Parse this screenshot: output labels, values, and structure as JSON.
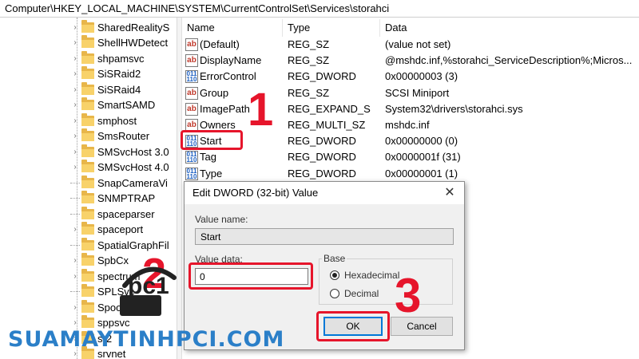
{
  "address_bar": "Computer\\HKEY_LOCAL_MACHINE\\SYSTEM\\CurrentControlSet\\Services\\storahci",
  "tree": {
    "items": [
      {
        "label": "SharedRealityS",
        "expandable": true
      },
      {
        "label": "ShellHWDetect",
        "expandable": true
      },
      {
        "label": "shpamsvc",
        "expandable": true
      },
      {
        "label": "SiSRaid2",
        "expandable": true
      },
      {
        "label": "SiSRaid4",
        "expandable": true
      },
      {
        "label": "SmartSAMD",
        "expandable": true
      },
      {
        "label": "smphost",
        "expandable": true
      },
      {
        "label": "SmsRouter",
        "expandable": true
      },
      {
        "label": "SMSvcHost 3.0",
        "expandable": true
      },
      {
        "label": "SMSvcHost 4.0",
        "expandable": true
      },
      {
        "label": "SnapCameraVi",
        "expandable": false
      },
      {
        "label": "SNMPTRAP",
        "expandable": false
      },
      {
        "label": "spaceparser",
        "expandable": false
      },
      {
        "label": "spaceport",
        "expandable": true
      },
      {
        "label": "SpatialGraphFil",
        "expandable": false
      },
      {
        "label": "SpbCx",
        "expandable": true
      },
      {
        "label": "spectrum",
        "expandable": true
      },
      {
        "label": "SPLSvc",
        "expandable": false
      },
      {
        "label": "Spooler",
        "expandable": true
      },
      {
        "label": "sppsvc",
        "expandable": true
      },
      {
        "label": "sr2",
        "expandable": true
      },
      {
        "label": "srvnet",
        "expandable": true
      }
    ]
  },
  "values_table": {
    "headers": {
      "name": "Name",
      "type": "Type",
      "data": "Data"
    },
    "rows": [
      {
        "icon": "ab",
        "name": "(Default)",
        "type": "REG_SZ",
        "data": "(value not set)"
      },
      {
        "icon": "ab",
        "name": "DisplayName",
        "type": "REG_SZ",
        "data": "@mshdc.inf,%storahci_ServiceDescription%;Micros..."
      },
      {
        "icon": "bin",
        "name": "ErrorControl",
        "type": "REG_DWORD",
        "data": "0x00000003 (3)"
      },
      {
        "icon": "ab",
        "name": "Group",
        "type": "REG_SZ",
        "data": "SCSI Miniport"
      },
      {
        "icon": "ab",
        "name": "ImagePath",
        "type": "REG_EXPAND_SZ",
        "data": "System32\\drivers\\storahci.sys"
      },
      {
        "icon": "ab",
        "name": "Owners",
        "type": "REG_MULTI_SZ",
        "data": "mshdc.inf"
      },
      {
        "icon": "bin",
        "name": "Start",
        "type": "REG_DWORD",
        "data": "0x00000000 (0)"
      },
      {
        "icon": "bin",
        "name": "Tag",
        "type": "REG_DWORD",
        "data": "0x0000001f (31)"
      },
      {
        "icon": "bin",
        "name": "Type",
        "type": "REG_DWORD",
        "data": "0x00000001 (1)"
      }
    ]
  },
  "dialog": {
    "title": "Edit DWORD (32-bit) Value",
    "close_glyph": "✕",
    "value_name_label": "Value name:",
    "value_name": "Start",
    "value_data_label": "Value data:",
    "value_data": "0",
    "base_label": "Base",
    "base_options": [
      "Hexadecimal",
      "Decimal"
    ],
    "base_selected": "Hexadecimal",
    "ok_label": "OK",
    "cancel_label": "Cancel"
  },
  "annotations": {
    "step1": "1",
    "step2": "2",
    "step3": "3"
  },
  "watermark": {
    "text": "SUAMAYTINHPCI.COM",
    "logo_text": "pc1"
  },
  "colors": {
    "highlight": "#e6152b",
    "watermark": "#2b7fc8",
    "accent": "#0078d7",
    "folder": "#f8d26a"
  },
  "icons": {
    "string_value": "ab-icon",
    "dword_value": "binary-icon",
    "folder": "folder-icon",
    "close": "close-icon"
  }
}
